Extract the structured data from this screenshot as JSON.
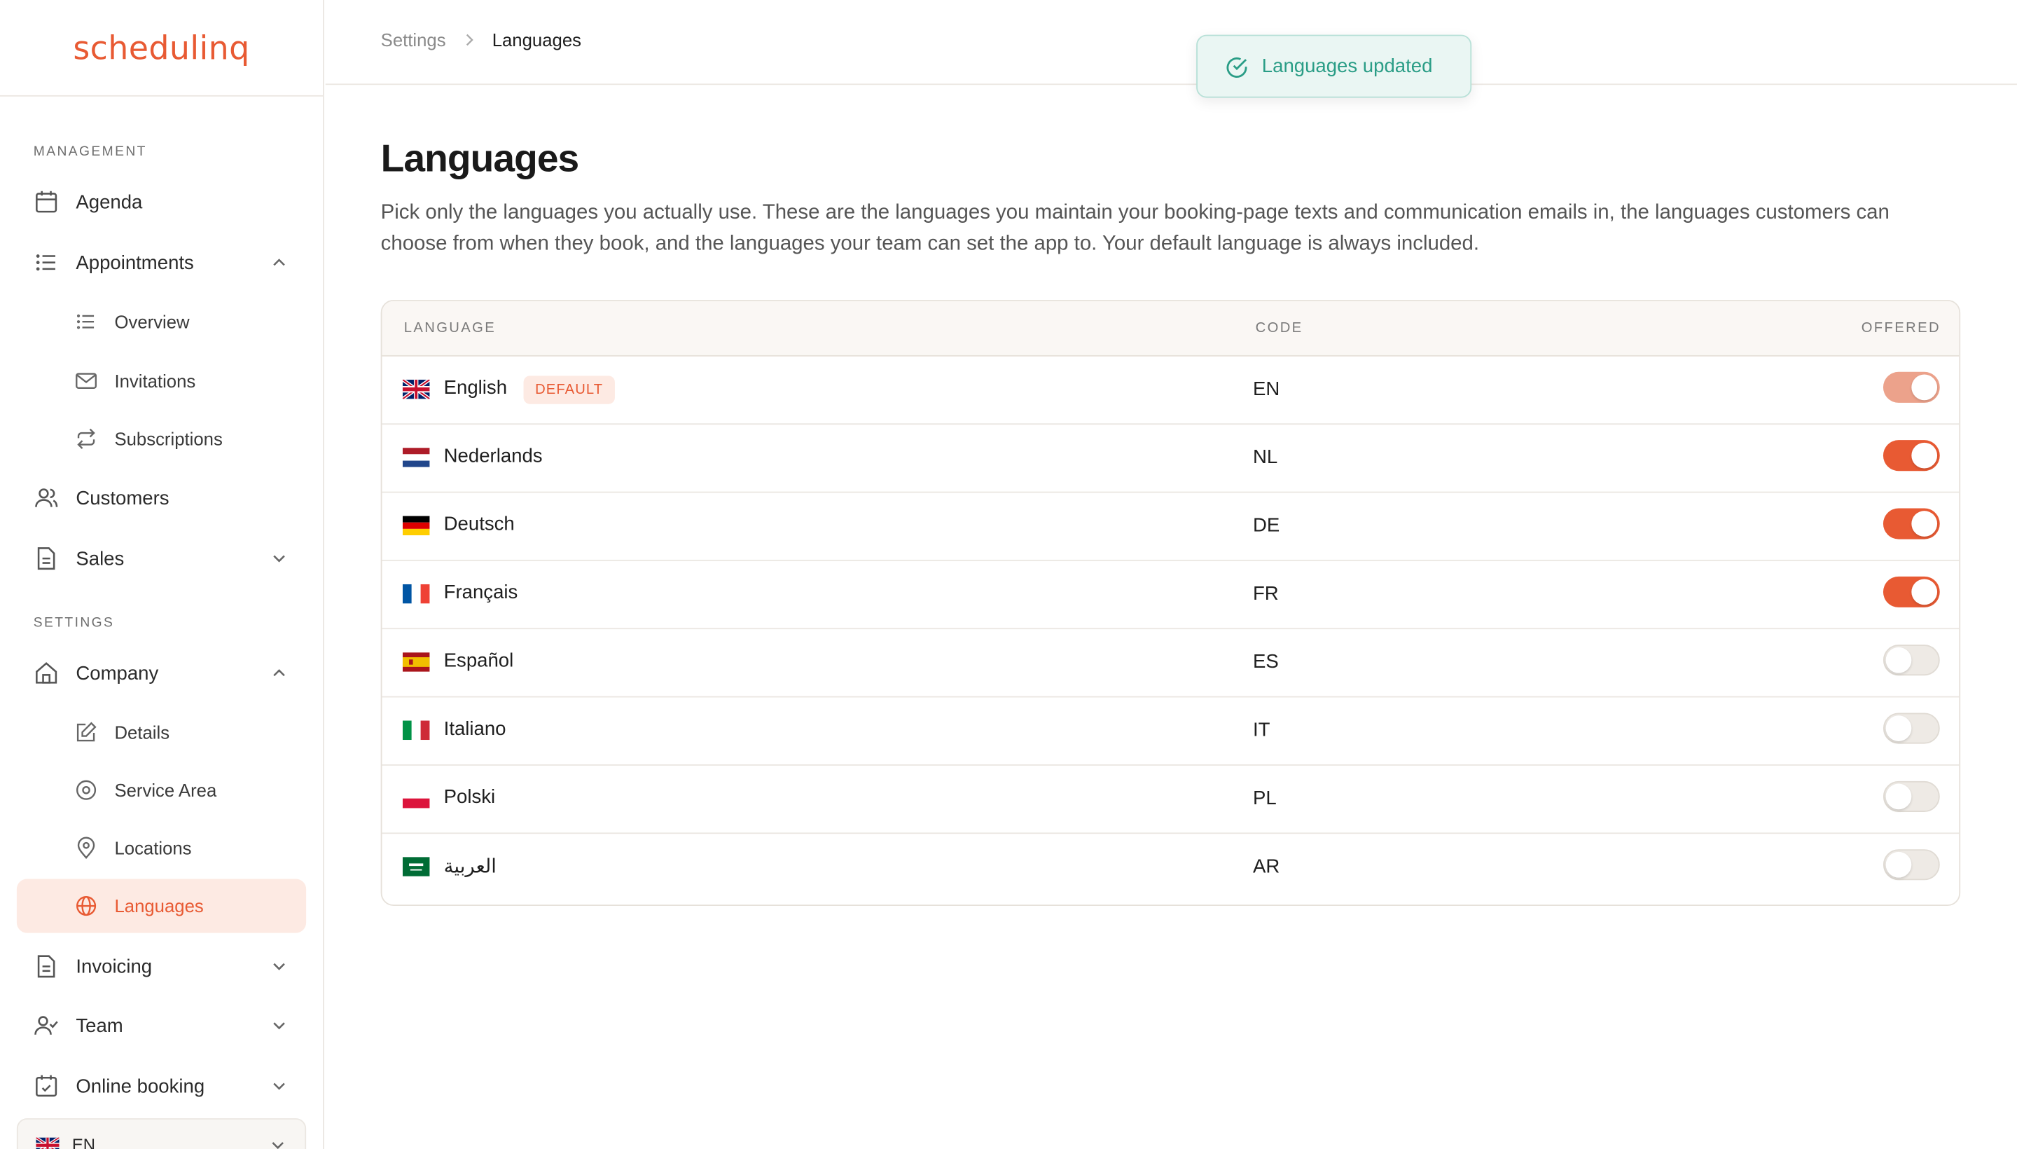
{
  "app": {
    "logo": "schedulinq"
  },
  "sidebar": {
    "management_label": "MANAGEMENT",
    "settings_label": "SETTINGS",
    "items": {
      "agenda": "Agenda",
      "appointments": "Appointments",
      "overview": "Overview",
      "invitations": "Invitations",
      "subscriptions": "Subscriptions",
      "customers": "Customers",
      "sales": "Sales",
      "company": "Company",
      "details": "Details",
      "service_area": "Service Area",
      "locations": "Locations",
      "languages": "Languages",
      "invoicing": "Invoicing",
      "team": "Team",
      "online_booking": "Online booking"
    },
    "language_selector": "EN"
  },
  "breadcrumb": {
    "parent": "Settings",
    "current": "Languages"
  },
  "toast": {
    "message": "Languages updated"
  },
  "page": {
    "title": "Languages",
    "description": "Pick only the languages you actually use. These are the languages you maintain your booking-page texts and communication emails in, the languages customers can choose from when they book, and the languages your team can set the app to. Your default language is always included."
  },
  "table": {
    "headers": {
      "language": "LANGUAGE",
      "code": "CODE",
      "offered": "OFFERED"
    },
    "default_badge": "DEFAULT",
    "rows": [
      {
        "name": "English",
        "code": "EN",
        "offered": true,
        "default": true,
        "flag": "uk-flag"
      },
      {
        "name": "Nederlands",
        "code": "NL",
        "offered": true,
        "default": false,
        "flag": "nl-flag"
      },
      {
        "name": "Deutsch",
        "code": "DE",
        "offered": true,
        "default": false,
        "flag": "de-flag"
      },
      {
        "name": "Français",
        "code": "FR",
        "offered": true,
        "default": false,
        "flag": "fr-flag"
      },
      {
        "name": "Español",
        "code": "ES",
        "offered": false,
        "default": false,
        "flag": "es-flag"
      },
      {
        "name": "Italiano",
        "code": "IT",
        "offered": false,
        "default": false,
        "flag": "it-flag"
      },
      {
        "name": "Polski",
        "code": "PL",
        "offered": false,
        "default": false,
        "flag": "pl-flag"
      },
      {
        "name": "العربية",
        "code": "AR",
        "offered": false,
        "default": false,
        "flag": "sa-flag"
      }
    ]
  },
  "colors": {
    "accent": "#e85a33",
    "accent_soft": "#fdeae3",
    "success": "#2a9d86",
    "toggle_off": "#eeeae5"
  }
}
